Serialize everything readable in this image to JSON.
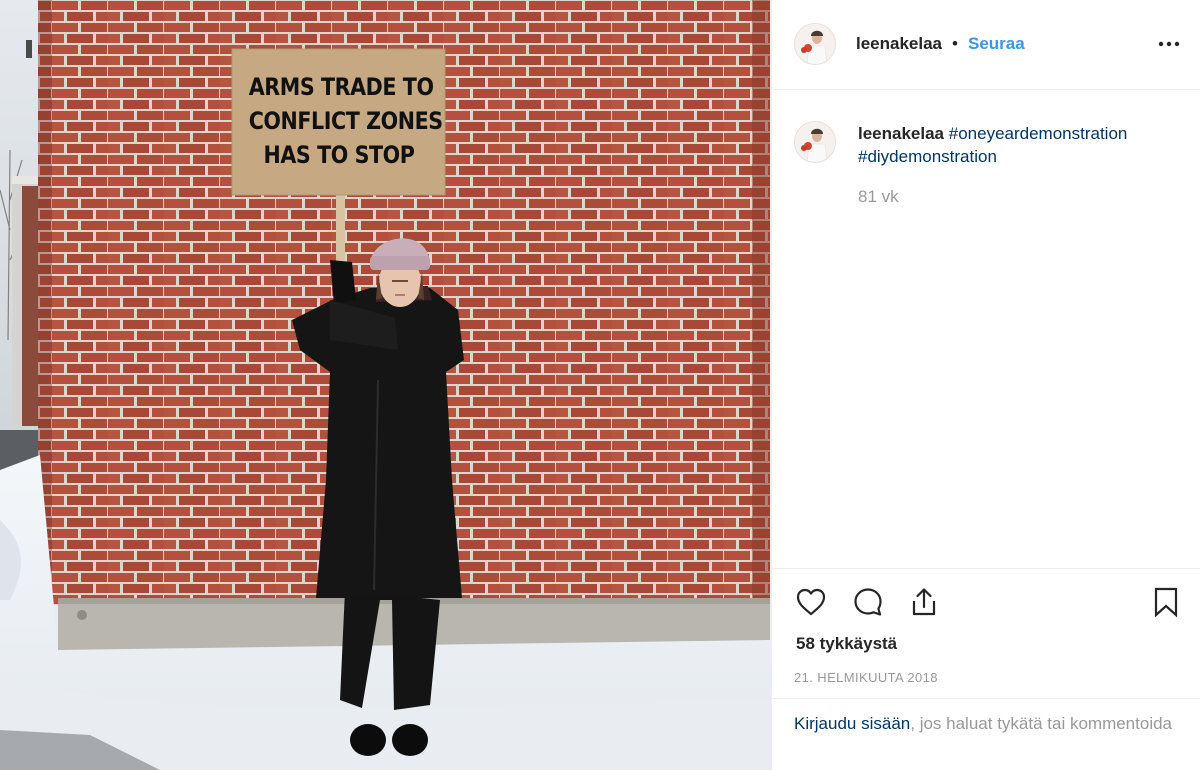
{
  "post": {
    "sign_lines": [
      "ARMS TRADE TO",
      "CONFLICT ZONES",
      "HAS TO STOP"
    ]
  },
  "header": {
    "username": "leenakelaa",
    "separator": "•",
    "follow_label": "Seuraa",
    "more_icon": "more-horizontal-icon"
  },
  "comment": {
    "username": "leenakelaa",
    "hashtags": [
      "#oneyeardemonstration",
      "#diydemonstration"
    ],
    "time": "81 vk"
  },
  "actions": {
    "icons": [
      "heart-icon",
      "comment-icon",
      "share-icon",
      "bookmark-icon"
    ],
    "likes": "58 tykkäystä",
    "date": "21. HELMIKUUTA 2018"
  },
  "login": {
    "link": "Kirjaudu sisään",
    "text": ", jos haluat tykätä tai kommentoida"
  },
  "colors": {
    "follow": "#3897f0",
    "hashtag": "#003569",
    "muted": "#999999",
    "divider": "#efefef"
  }
}
